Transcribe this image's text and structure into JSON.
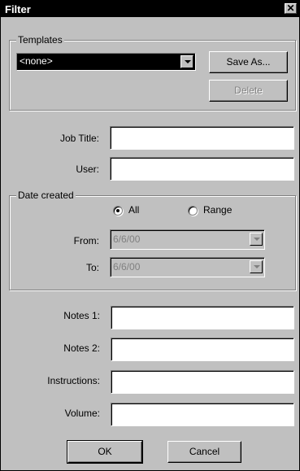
{
  "window": {
    "title": "Filter",
    "close_glyph": "✕"
  },
  "templates": {
    "group_label": "Templates",
    "selected": "<none>",
    "save_as_label": "Save As...",
    "delete_label": "Delete"
  },
  "fields": {
    "job_title_label": "Job Title:",
    "job_title_value": "",
    "user_label": "User:",
    "user_value": ""
  },
  "date_created": {
    "group_label": "Date created",
    "all_label": "All",
    "range_label": "Range",
    "selected_option": "All",
    "from_label": "From:",
    "from_value": "6/6/00",
    "to_label": "To:",
    "to_value": "6/6/00"
  },
  "notes": {
    "notes1_label": "Notes 1:",
    "notes1_value": "",
    "notes2_label": "Notes 2:",
    "notes2_value": "",
    "instructions_label": "Instructions:",
    "instructions_value": "",
    "volume_label": "Volume:",
    "volume_value": ""
  },
  "footer": {
    "ok_label": "OK",
    "cancel_label": "Cancel"
  }
}
